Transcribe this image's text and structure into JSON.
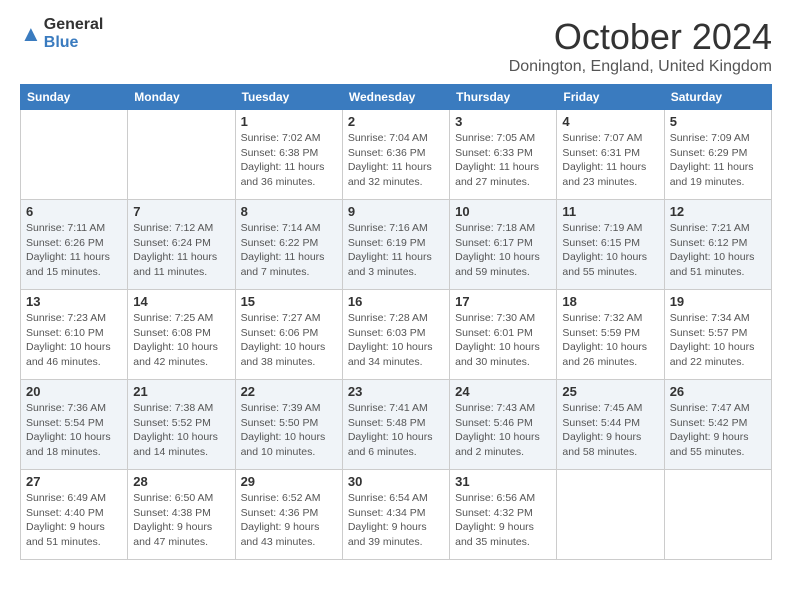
{
  "header": {
    "logo_general": "General",
    "logo_blue": "Blue",
    "month": "October 2024",
    "location": "Donington, England, United Kingdom"
  },
  "weekdays": [
    "Sunday",
    "Monday",
    "Tuesday",
    "Wednesday",
    "Thursday",
    "Friday",
    "Saturday"
  ],
  "weeks": [
    {
      "shaded": false,
      "days": [
        {
          "num": "",
          "info": ""
        },
        {
          "num": "",
          "info": ""
        },
        {
          "num": "1",
          "info": "Sunrise: 7:02 AM\nSunset: 6:38 PM\nDaylight: 11 hours and 36 minutes."
        },
        {
          "num": "2",
          "info": "Sunrise: 7:04 AM\nSunset: 6:36 PM\nDaylight: 11 hours and 32 minutes."
        },
        {
          "num": "3",
          "info": "Sunrise: 7:05 AM\nSunset: 6:33 PM\nDaylight: 11 hours and 27 minutes."
        },
        {
          "num": "4",
          "info": "Sunrise: 7:07 AM\nSunset: 6:31 PM\nDaylight: 11 hours and 23 minutes."
        },
        {
          "num": "5",
          "info": "Sunrise: 7:09 AM\nSunset: 6:29 PM\nDaylight: 11 hours and 19 minutes."
        }
      ]
    },
    {
      "shaded": true,
      "days": [
        {
          "num": "6",
          "info": "Sunrise: 7:11 AM\nSunset: 6:26 PM\nDaylight: 11 hours and 15 minutes."
        },
        {
          "num": "7",
          "info": "Sunrise: 7:12 AM\nSunset: 6:24 PM\nDaylight: 11 hours and 11 minutes."
        },
        {
          "num": "8",
          "info": "Sunrise: 7:14 AM\nSunset: 6:22 PM\nDaylight: 11 hours and 7 minutes."
        },
        {
          "num": "9",
          "info": "Sunrise: 7:16 AM\nSunset: 6:19 PM\nDaylight: 11 hours and 3 minutes."
        },
        {
          "num": "10",
          "info": "Sunrise: 7:18 AM\nSunset: 6:17 PM\nDaylight: 10 hours and 59 minutes."
        },
        {
          "num": "11",
          "info": "Sunrise: 7:19 AM\nSunset: 6:15 PM\nDaylight: 10 hours and 55 minutes."
        },
        {
          "num": "12",
          "info": "Sunrise: 7:21 AM\nSunset: 6:12 PM\nDaylight: 10 hours and 51 minutes."
        }
      ]
    },
    {
      "shaded": false,
      "days": [
        {
          "num": "13",
          "info": "Sunrise: 7:23 AM\nSunset: 6:10 PM\nDaylight: 10 hours and 46 minutes."
        },
        {
          "num": "14",
          "info": "Sunrise: 7:25 AM\nSunset: 6:08 PM\nDaylight: 10 hours and 42 minutes."
        },
        {
          "num": "15",
          "info": "Sunrise: 7:27 AM\nSunset: 6:06 PM\nDaylight: 10 hours and 38 minutes."
        },
        {
          "num": "16",
          "info": "Sunrise: 7:28 AM\nSunset: 6:03 PM\nDaylight: 10 hours and 34 minutes."
        },
        {
          "num": "17",
          "info": "Sunrise: 7:30 AM\nSunset: 6:01 PM\nDaylight: 10 hours and 30 minutes."
        },
        {
          "num": "18",
          "info": "Sunrise: 7:32 AM\nSunset: 5:59 PM\nDaylight: 10 hours and 26 minutes."
        },
        {
          "num": "19",
          "info": "Sunrise: 7:34 AM\nSunset: 5:57 PM\nDaylight: 10 hours and 22 minutes."
        }
      ]
    },
    {
      "shaded": true,
      "days": [
        {
          "num": "20",
          "info": "Sunrise: 7:36 AM\nSunset: 5:54 PM\nDaylight: 10 hours and 18 minutes."
        },
        {
          "num": "21",
          "info": "Sunrise: 7:38 AM\nSunset: 5:52 PM\nDaylight: 10 hours and 14 minutes."
        },
        {
          "num": "22",
          "info": "Sunrise: 7:39 AM\nSunset: 5:50 PM\nDaylight: 10 hours and 10 minutes."
        },
        {
          "num": "23",
          "info": "Sunrise: 7:41 AM\nSunset: 5:48 PM\nDaylight: 10 hours and 6 minutes."
        },
        {
          "num": "24",
          "info": "Sunrise: 7:43 AM\nSunset: 5:46 PM\nDaylight: 10 hours and 2 minutes."
        },
        {
          "num": "25",
          "info": "Sunrise: 7:45 AM\nSunset: 5:44 PM\nDaylight: 9 hours and 58 minutes."
        },
        {
          "num": "26",
          "info": "Sunrise: 7:47 AM\nSunset: 5:42 PM\nDaylight: 9 hours and 55 minutes."
        }
      ]
    },
    {
      "shaded": false,
      "days": [
        {
          "num": "27",
          "info": "Sunrise: 6:49 AM\nSunset: 4:40 PM\nDaylight: 9 hours and 51 minutes."
        },
        {
          "num": "28",
          "info": "Sunrise: 6:50 AM\nSunset: 4:38 PM\nDaylight: 9 hours and 47 minutes."
        },
        {
          "num": "29",
          "info": "Sunrise: 6:52 AM\nSunset: 4:36 PM\nDaylight: 9 hours and 43 minutes."
        },
        {
          "num": "30",
          "info": "Sunrise: 6:54 AM\nSunset: 4:34 PM\nDaylight: 9 hours and 39 minutes."
        },
        {
          "num": "31",
          "info": "Sunrise: 6:56 AM\nSunset: 4:32 PM\nDaylight: 9 hours and 35 minutes."
        },
        {
          "num": "",
          "info": ""
        },
        {
          "num": "",
          "info": ""
        }
      ]
    }
  ]
}
